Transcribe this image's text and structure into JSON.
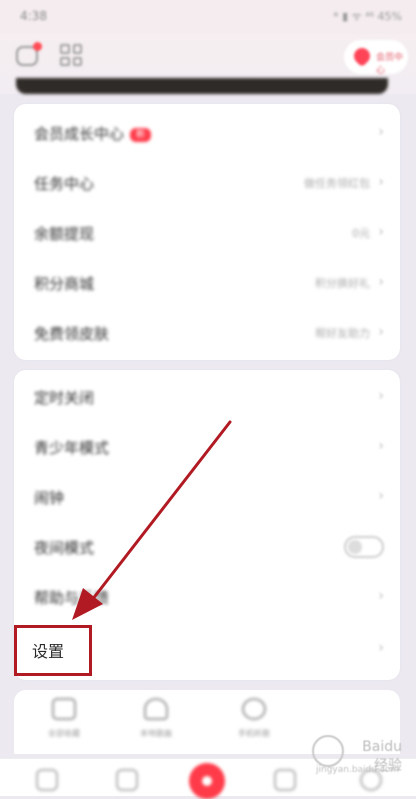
{
  "status_bar": {
    "time": "4:38",
    "icons": "* ▮ ᯤ ⁴⁶ 45%"
  },
  "header": {
    "vip_label": "会员中心"
  },
  "menu_group_1": [
    {
      "title": "会员成长中心",
      "badge": "新",
      "sub": ""
    },
    {
      "title": "任务中心",
      "badge": "",
      "sub": "做任务领红包"
    },
    {
      "title": "余额提现",
      "badge": "",
      "sub": "0元"
    },
    {
      "title": "积分商城",
      "badge": "",
      "sub": "积分换好礼"
    },
    {
      "title": "免费领皮肤",
      "badge": "",
      "sub": "帮好友助力"
    }
  ],
  "menu_group_2": [
    {
      "title": "定时关闭",
      "type": "chevron"
    },
    {
      "title": "青少年模式",
      "type": "chevron"
    },
    {
      "title": "闹钟",
      "type": "chevron"
    },
    {
      "title": "夜间模式",
      "type": "toggle"
    },
    {
      "title": "帮助与反馈",
      "type": "chevron"
    },
    {
      "title": "设置",
      "type": "chevron"
    }
  ],
  "quick_links": [
    "全部收藏",
    "本地歌曲",
    "手机听歌"
  ],
  "watermark": {
    "brand": "Baidu 经验",
    "sub": "jingyan.baidu.com"
  },
  "annotation": {
    "highlight_color": "#b11a22"
  }
}
